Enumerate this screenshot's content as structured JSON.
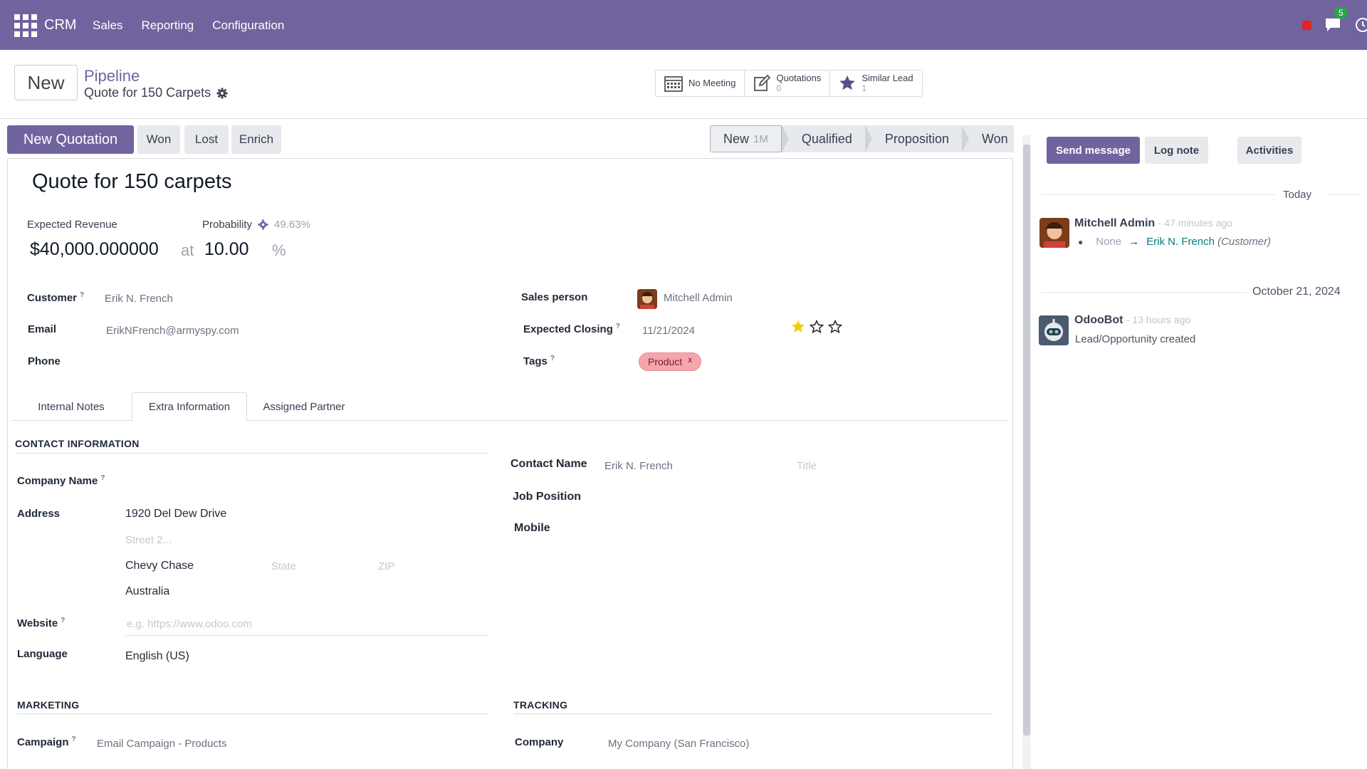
{
  "navbar": {
    "brand": "CRM",
    "menu": [
      "Sales",
      "Reporting",
      "Configuration"
    ],
    "messages_badge": "5"
  },
  "control": {
    "new_button": "New",
    "breadcrumb_parent": "Pipeline",
    "breadcrumb_current": "Quote for 150 Carpets",
    "smart_buttons": [
      {
        "label": "No Meeting",
        "count": "",
        "icon": "calendar-icon"
      },
      {
        "label": "Quotations",
        "count": "0",
        "icon": "edit-icon"
      },
      {
        "label": "Similar Lead",
        "count": "1",
        "icon": "star-icon"
      }
    ]
  },
  "actions": {
    "new_quotation": "New Quotation",
    "won": "Won",
    "lost": "Lost",
    "enrich": "Enrich"
  },
  "stages": [
    {
      "label": "New",
      "duration": "1M",
      "active": true
    },
    {
      "label": "Qualified",
      "duration": "",
      "active": false
    },
    {
      "label": "Proposition",
      "duration": "",
      "active": false
    },
    {
      "label": "Won",
      "duration": "",
      "active": false
    }
  ],
  "form": {
    "title": "Quote for 150 carpets",
    "expected_revenue_label": "Expected Revenue",
    "probability_label": "Probability",
    "probability_auto": "49.63%",
    "expected_revenue": "$40,000.000000",
    "at": "at",
    "probability": "10.00",
    "percent": "%",
    "customer_label": "Customer",
    "customer": "Erik N. French",
    "email_label": "Email",
    "email": "ErikNFrench@armyspy.com",
    "phone_label": "Phone",
    "salesperson_label": "Sales person",
    "salesperson": "Mitchell Admin",
    "expected_closing_label": "Expected Closing",
    "expected_closing": "11/21/2024",
    "priority_stars": 1,
    "priority_max": 3,
    "tags_label": "Tags",
    "tag": "Product",
    "tag_remove": "x"
  },
  "tabs": [
    "Internal Notes",
    "Extra Information",
    "Assigned Partner"
  ],
  "extra": {
    "contact_info_title": "CONTACT INFORMATION",
    "company_name_label": "Company Name",
    "address_label": "Address",
    "street": "1920 Del Dew Drive",
    "street2_placeholder": "Street 2...",
    "city": "Chevy Chase",
    "state_placeholder": "State",
    "zip_placeholder": "ZIP",
    "country": "Australia",
    "website_label": "Website",
    "website_placeholder": "e.g. https://www.odoo.com",
    "language_label": "Language",
    "language": "English (US)",
    "contact_name_label": "Contact Name",
    "contact_name": "Erik N. French",
    "title_placeholder": "Title",
    "job_position_label": "Job Position",
    "mobile_label": "Mobile",
    "marketing_title": "MARKETING",
    "campaign_label": "Campaign",
    "campaign": "Email Campaign - Products",
    "tracking_title": "TRACKING",
    "company_label": "Company",
    "company": "My Company (San Francisco)"
  },
  "chatter": {
    "send_message": "Send message",
    "log_note": "Log note",
    "activities": "Activities",
    "today": "Today",
    "msg1_author": "Mitchell Admin",
    "msg1_time": "- 47 minutes ago",
    "msg1_old": "None",
    "msg1_new": "Erik N. French",
    "msg1_field": "(Customer)",
    "date2": "October 21, 2024",
    "msg2_author": "OdooBot",
    "msg2_time": "- 13 hours ago",
    "msg2_body": "Lead/Opportunity created"
  },
  "colors": {
    "brand": "#71639e",
    "tag_bg": "#f4a6ad",
    "link": "#017e84",
    "star": "#f3cc00"
  }
}
